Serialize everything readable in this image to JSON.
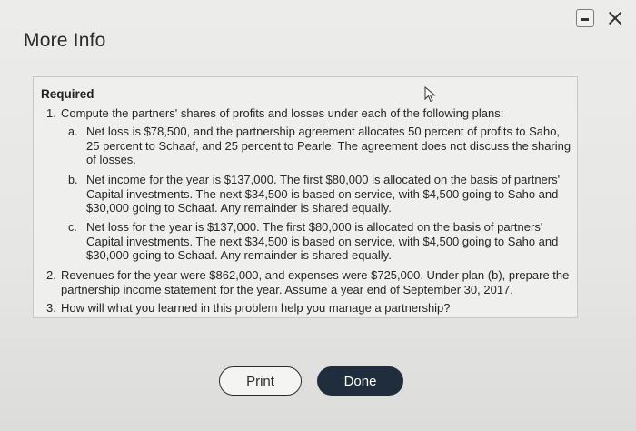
{
  "dialog": {
    "title": "More Info",
    "controls": {
      "minimize_icon": "minimize-icon",
      "close_icon": "close-icon"
    }
  },
  "content": {
    "heading": "Required",
    "items": [
      {
        "number": "1.",
        "text": "Compute the partners' shares of profits and losses under each of the following plans:",
        "subitems": [
          {
            "letter": "a.",
            "lines": [
              "Net loss is $78,500, and the partnership agreement allocates 50 percent of profits to Saho,",
              "25 percent to Schaaf, and 25 percent to Pearle. The agreement does not discuss the sharing",
              "of losses."
            ]
          },
          {
            "letter": "b.",
            "lines": [
              "Net income for the year is $137,000. The first $80,000 is allocated on the basis of partners'",
              "Capital investments. The next $34,500 is based on service, with $4,500 going to Saho and",
              "$30,000 going to Schaaf. Any remainder is shared equally."
            ]
          },
          {
            "letter": "c.",
            "lines": [
              "Net loss for the year is $137,000. The first $80,000 is allocated on the basis of partners'",
              "Capital investments. The next $34,500 is based on service, with $4,500 going to Saho and",
              "$30,000 going to Schaaf. Any remainder is shared equally."
            ]
          }
        ]
      },
      {
        "number": "2.",
        "lines": [
          "Revenues for the year were $862,000, and expenses were $725,000. Under plan (b), prepare the",
          "partnership income statement for the year. Assume a year end of September 30, 2017."
        ]
      },
      {
        "number": "3.",
        "text": "How will what you learned in this problem help you manage a partnership?"
      }
    ]
  },
  "buttons": {
    "print": "Print",
    "done": "Done"
  }
}
